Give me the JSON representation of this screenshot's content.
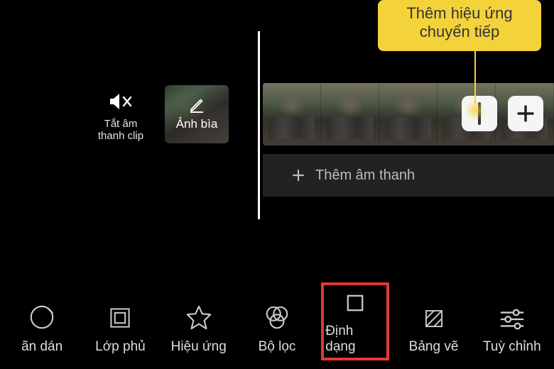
{
  "tooltip": {
    "line1": "Thêm hiệu ứng",
    "line2": "chuyển tiếp"
  },
  "mute": {
    "label_line1": "Tắt âm",
    "label_line2": "thanh clip"
  },
  "cover": {
    "label": "Ảnh bìa"
  },
  "audio": {
    "label": "Thêm âm thanh"
  },
  "toolbar": {
    "sticker": "ãn dán",
    "overlay": "Lớp phủ",
    "effect": "Hiệu ứng",
    "filter": "Bộ lọc",
    "format": "Định dạng",
    "canvas": "Bảng vẽ",
    "adjust": "Tuỳ chỉnh"
  }
}
